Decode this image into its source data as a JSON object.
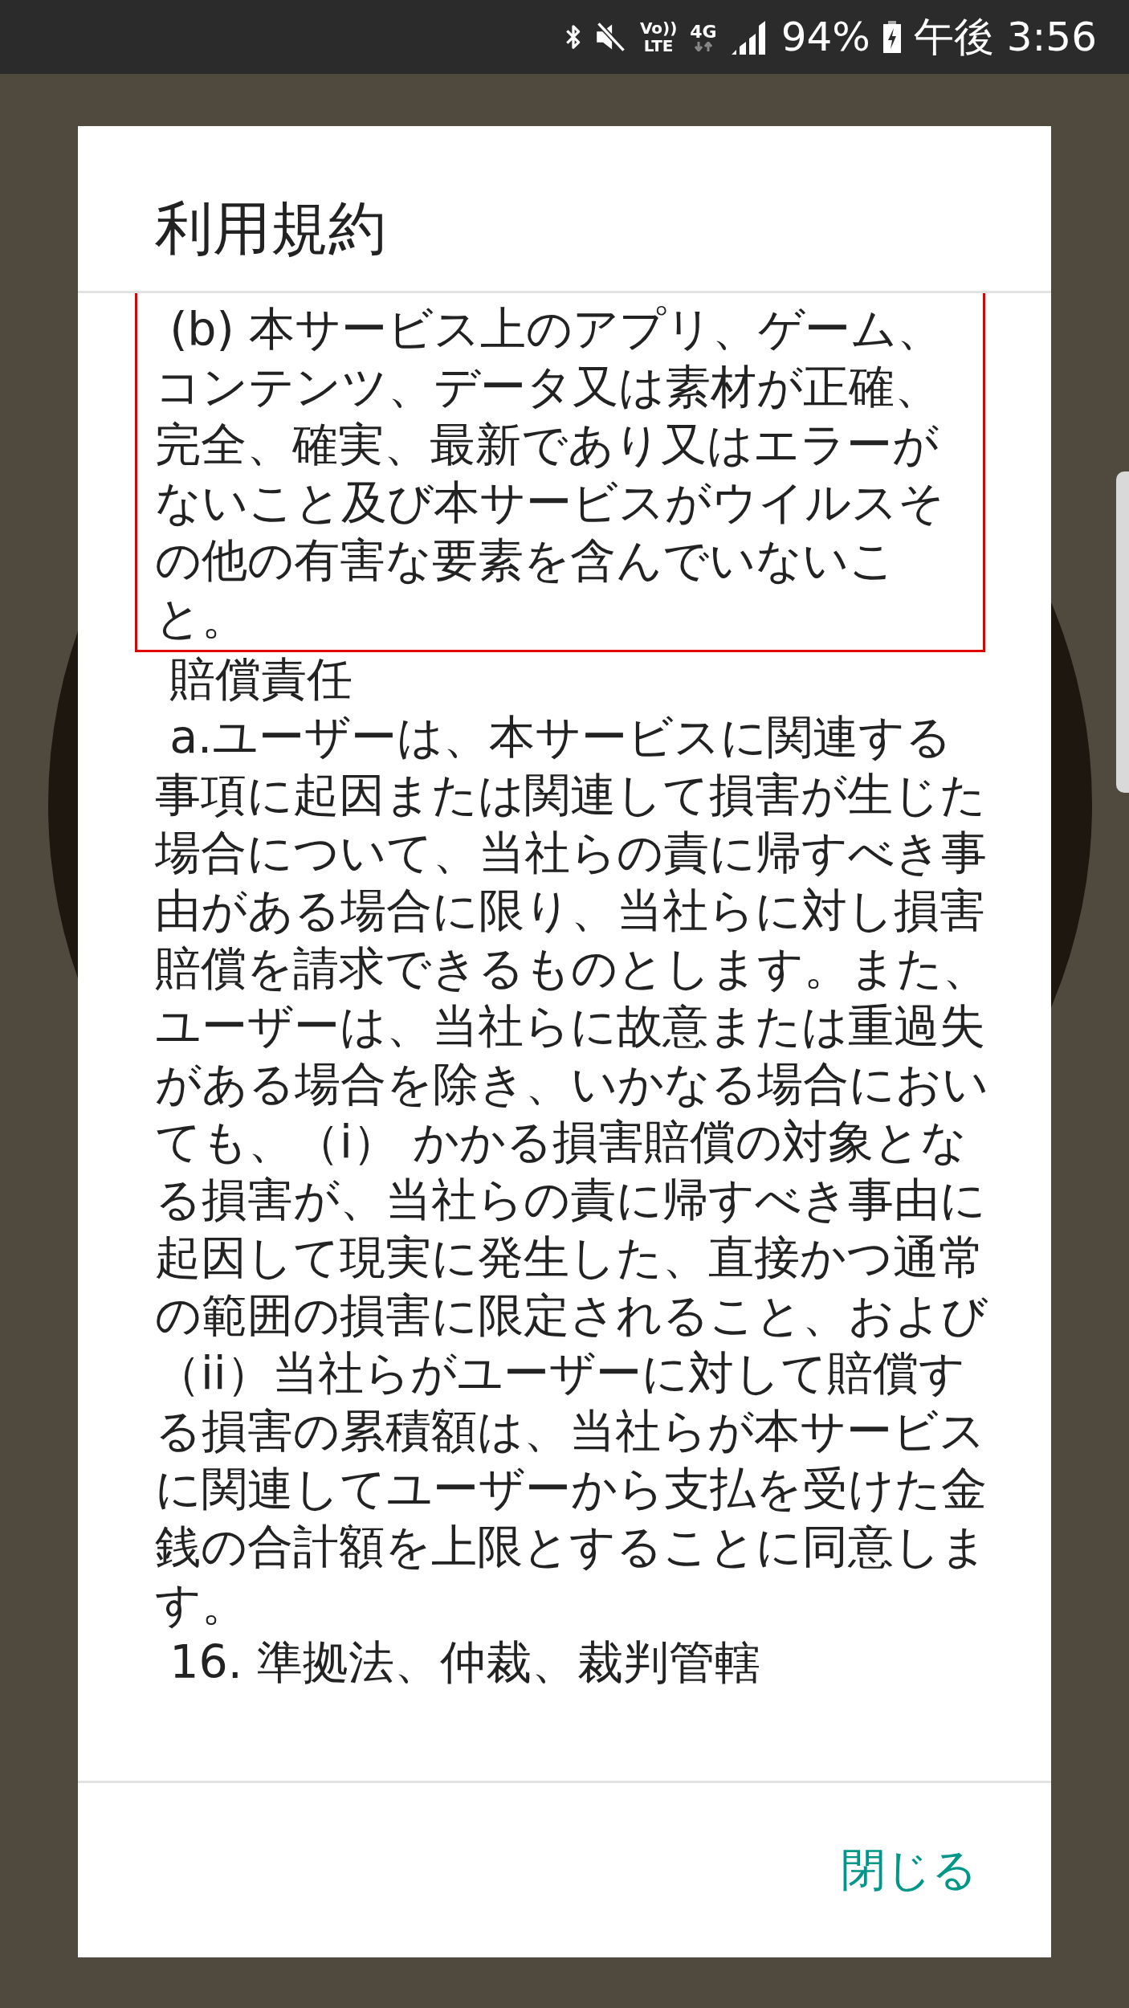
{
  "status_bar": {
    "volte_top": "Vo))",
    "volte_bottom": "LTE",
    "network": "4G",
    "battery": "94%",
    "time": "午後 3:56"
  },
  "dialog": {
    "title": "利用規約",
    "paragraphs": [
      {
        "text": " (b) 本サービス上のアプリ、ゲーム、コンテンツ、データ又は素材が正確、完全、確実、最新であり又はエラーがないこと及び本サービスがウイルスその他の有害な要素を含んでいないこと。",
        "highlighted": true
      },
      {
        "text": " 賠償責任",
        "highlighted": false
      },
      {
        "text": " a.ユーザーは、本サービスに関連する事項に起因または関連して損害が生じた場合について、当社らの責に帰すべき事由がある場合に限り、当社らに対し損害賠償を請求できるものとします。また、ユーザーは、当社らに故意または重過失がある場合を除き、いかなる場合においても、（i） かかる損害賠償の対象となる損害が、当社らの責に帰すべき事由に起因して現実に発生した、直接かつ通常の範囲の損害に限定されること、および（ii）当社らがユーザーに対して賠償する損害の累積額は、当社らが本サービスに関連してユーザーから支払を受けた金銭の合計額を上限とすることに同意します。",
        "highlighted": false
      },
      {
        "text": " 16. 準拠法、仲裁、裁判管轄",
        "highlighted": false
      }
    ],
    "close_button": "閉じる"
  }
}
